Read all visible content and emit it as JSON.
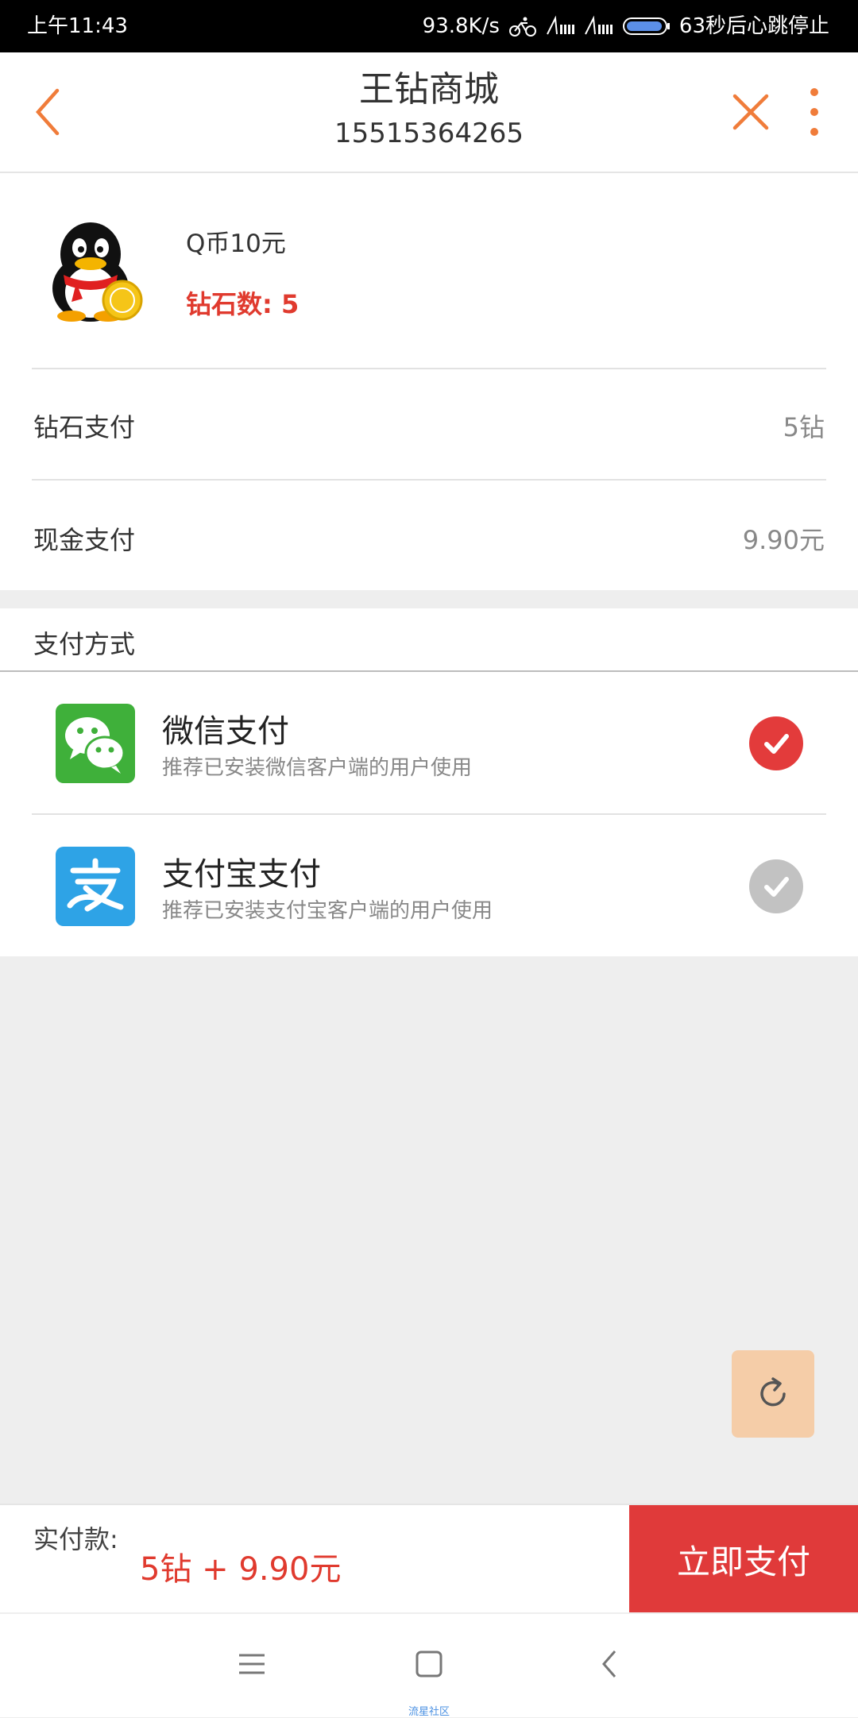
{
  "status_bar": {
    "time": "上午11:43",
    "network_speed": "93.8K/s",
    "heartbeat": "63秒后心跳停止"
  },
  "header": {
    "title": "王钻商城",
    "subtitle": "15515364265"
  },
  "product": {
    "name": "Q币10元",
    "diamond_count": "钻石数: 5"
  },
  "payment_summary": {
    "diamond_label": "钻石支付",
    "diamond_value": "5钻",
    "cash_label": "现金支付",
    "cash_value": "9.90元"
  },
  "payment_methods": {
    "title": "支付方式",
    "items": [
      {
        "name": "微信支付",
        "desc": "推荐已安装微信客户端的用户使用",
        "selected": true,
        "icon": "wechat-icon",
        "color": "#3fb03a"
      },
      {
        "name": "支付宝支付",
        "desc": "推荐已安装支付宝客户端的用户使用",
        "selected": false,
        "icon": "alipay-icon",
        "color": "#2ea3e6"
      }
    ]
  },
  "bottom_bar": {
    "pay_label": "实付款:",
    "pay_amount": "5钻 + 9.90元",
    "pay_button": "立即支付"
  },
  "watermark": "流星社区",
  "colors": {
    "accent": "#f07c3a",
    "red": "#e03a2e",
    "button_red": "#e03a3a",
    "selected_radio": "#e33b3b",
    "unselected_radio": "#c2c2c2"
  }
}
